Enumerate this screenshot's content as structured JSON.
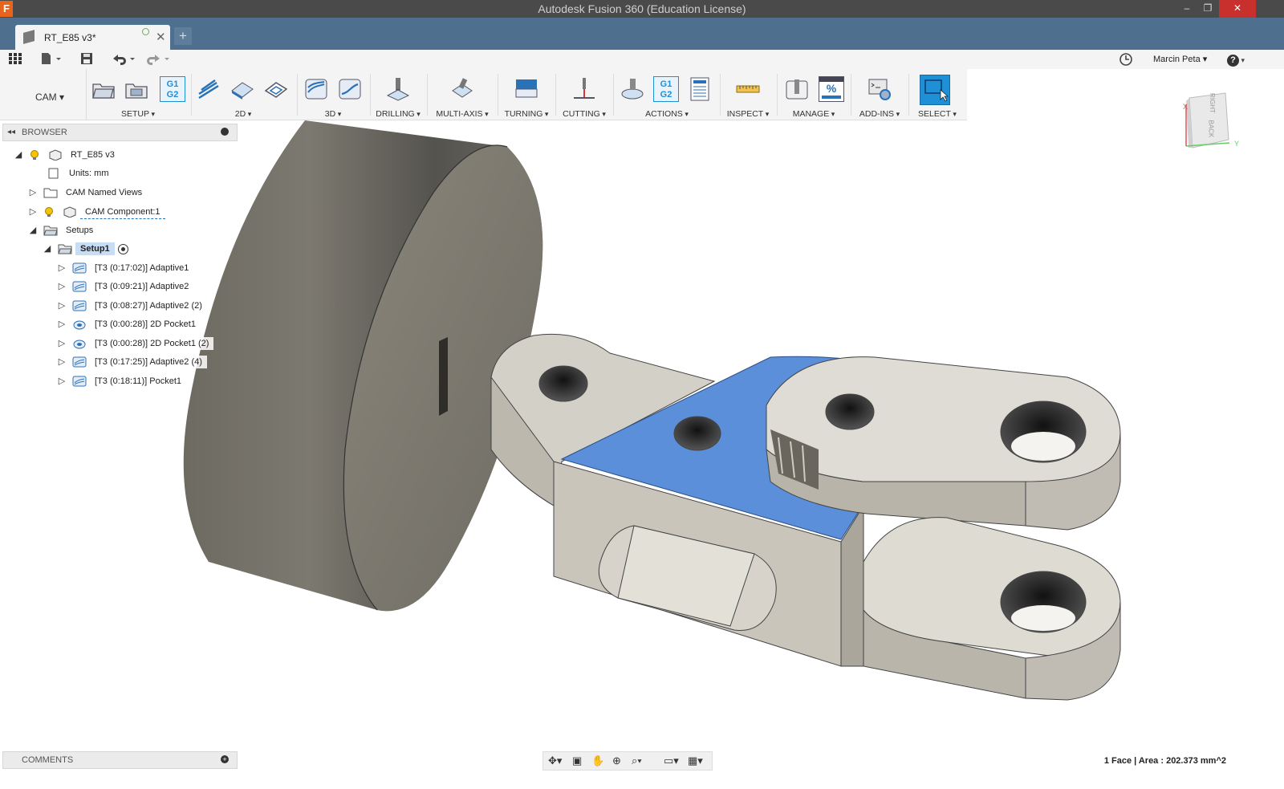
{
  "window": {
    "title": "Autodesk Fusion 360 (Education License)",
    "logo": "F",
    "minimize": "–",
    "restore": "❐",
    "close": "✕"
  },
  "tab": {
    "name": "RT_E85 v3*",
    "close": "✕",
    "new_tab": "+"
  },
  "qat": {
    "user": "Marcin Peta",
    "help": "?"
  },
  "ribbon": {
    "workspace": "CAM",
    "groups": {
      "setup": "SETUP",
      "twod": "2D",
      "threed": "3D",
      "drilling": "DRILLING",
      "multiaxis": "MULTI-AXIS",
      "turning": "TURNING",
      "cutting": "CUTTING",
      "actions": "ACTIONS",
      "inspect": "INSPECT",
      "manage": "MANAGE",
      "addins": "ADD-INS",
      "select": "SELECT"
    },
    "g1g2": "G1 G2",
    "percent": "%"
  },
  "browser": {
    "title": "BROWSER",
    "root": "RT_E85 v3",
    "units": "Units: mm",
    "named_views": "CAM Named Views",
    "component": "CAM Component:1",
    "setups": "Setups",
    "setup1": "Setup1",
    "ops": [
      "[T3 (0:17:02)] Adaptive1",
      "[T3 (0:09:21)] Adaptive2",
      "[T3 (0:08:27)] Adaptive2 (2)",
      "[T3 (0:00:28)] 2D Pocket1",
      "[T3 (0:00:28)] 2D Pocket1 (2)",
      "[T3 (0:17:25)] Adaptive2 (4)",
      "[T3 (0:18:11)] Pocket1"
    ]
  },
  "viewcube": {
    "right": "RIGHT",
    "back": "BACK",
    "x_axis": "X",
    "y_axis": "Y"
  },
  "comments": "COMMENTS",
  "status": "1 Face | Area : 202.373 mm^2",
  "colors": {
    "title_bg": "#4a4a4a",
    "tab_bg": "#4f6f8f",
    "accent": "#1f8fd6",
    "selection": "#5b8fd9",
    "part": "#d8d5ce"
  }
}
